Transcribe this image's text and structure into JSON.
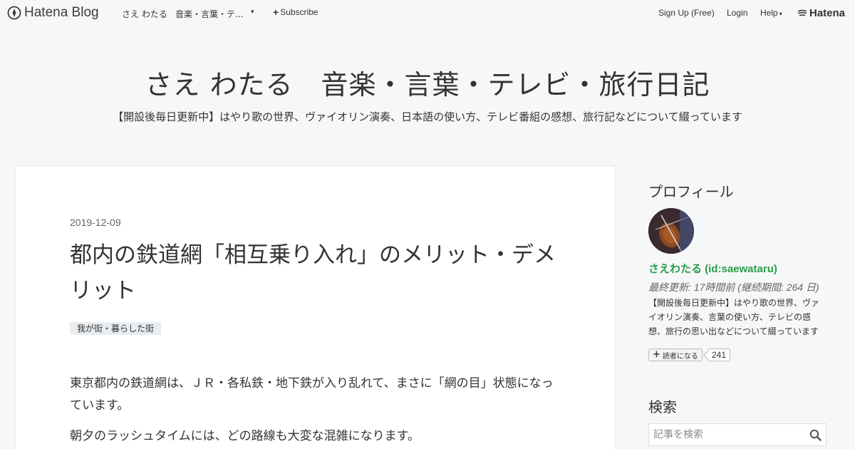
{
  "topbar": {
    "logo": "Hatena Blog",
    "blog_name": "さえ わたる",
    "blog_title_short": "音楽・言葉・テ...",
    "caret": "▾",
    "subscribe": "Subscribe",
    "signup": "Sign Up (Free)",
    "login": "Login",
    "help": "Help",
    "help_caret": "▾",
    "hatena": "Hatena"
  },
  "header": {
    "title": "さえ わたる　音楽・言葉・テレビ・旅行日記",
    "description": "【開設後毎日更新中】はやり歌の世界、ヴァイオリン演奏、日本語の使い方、テレビ番組の感想、旅行記などについて綴っています"
  },
  "entry": {
    "date": "2019-12-09",
    "title": "都内の鉄道網「相互乗り入れ」のメリット・デメリット",
    "category": "我が街・暮らした街",
    "paragraphs": [
      "東京都内の鉄道網は、ＪＲ・各私鉄・地下鉄が入り乱れて、まさに「網の目」状態になっています。",
      "朝夕のラッシュタイムには、どの路線も大変な混雑になります。"
    ]
  },
  "sidebar": {
    "profile_heading": "プロフィール",
    "profile_name": "さえわたる (id:saewataru)",
    "last_updated": "最終更新: 17時間前 (継続期間: 264 日)",
    "profile_desc": "【開設後毎日更新中】はやり歌の世界、ヴァイオリン演奏、言葉の使い方、テレビの感想、旅行の思い出などについて綴っています",
    "reader_button": "読者になる",
    "reader_count": "241",
    "search_heading": "検索",
    "search_placeholder": "記事を検索"
  },
  "colors": {
    "background": "#f6f7f9",
    "profile_name": "#2a9d48",
    "category_bg": "#e9edf0"
  }
}
